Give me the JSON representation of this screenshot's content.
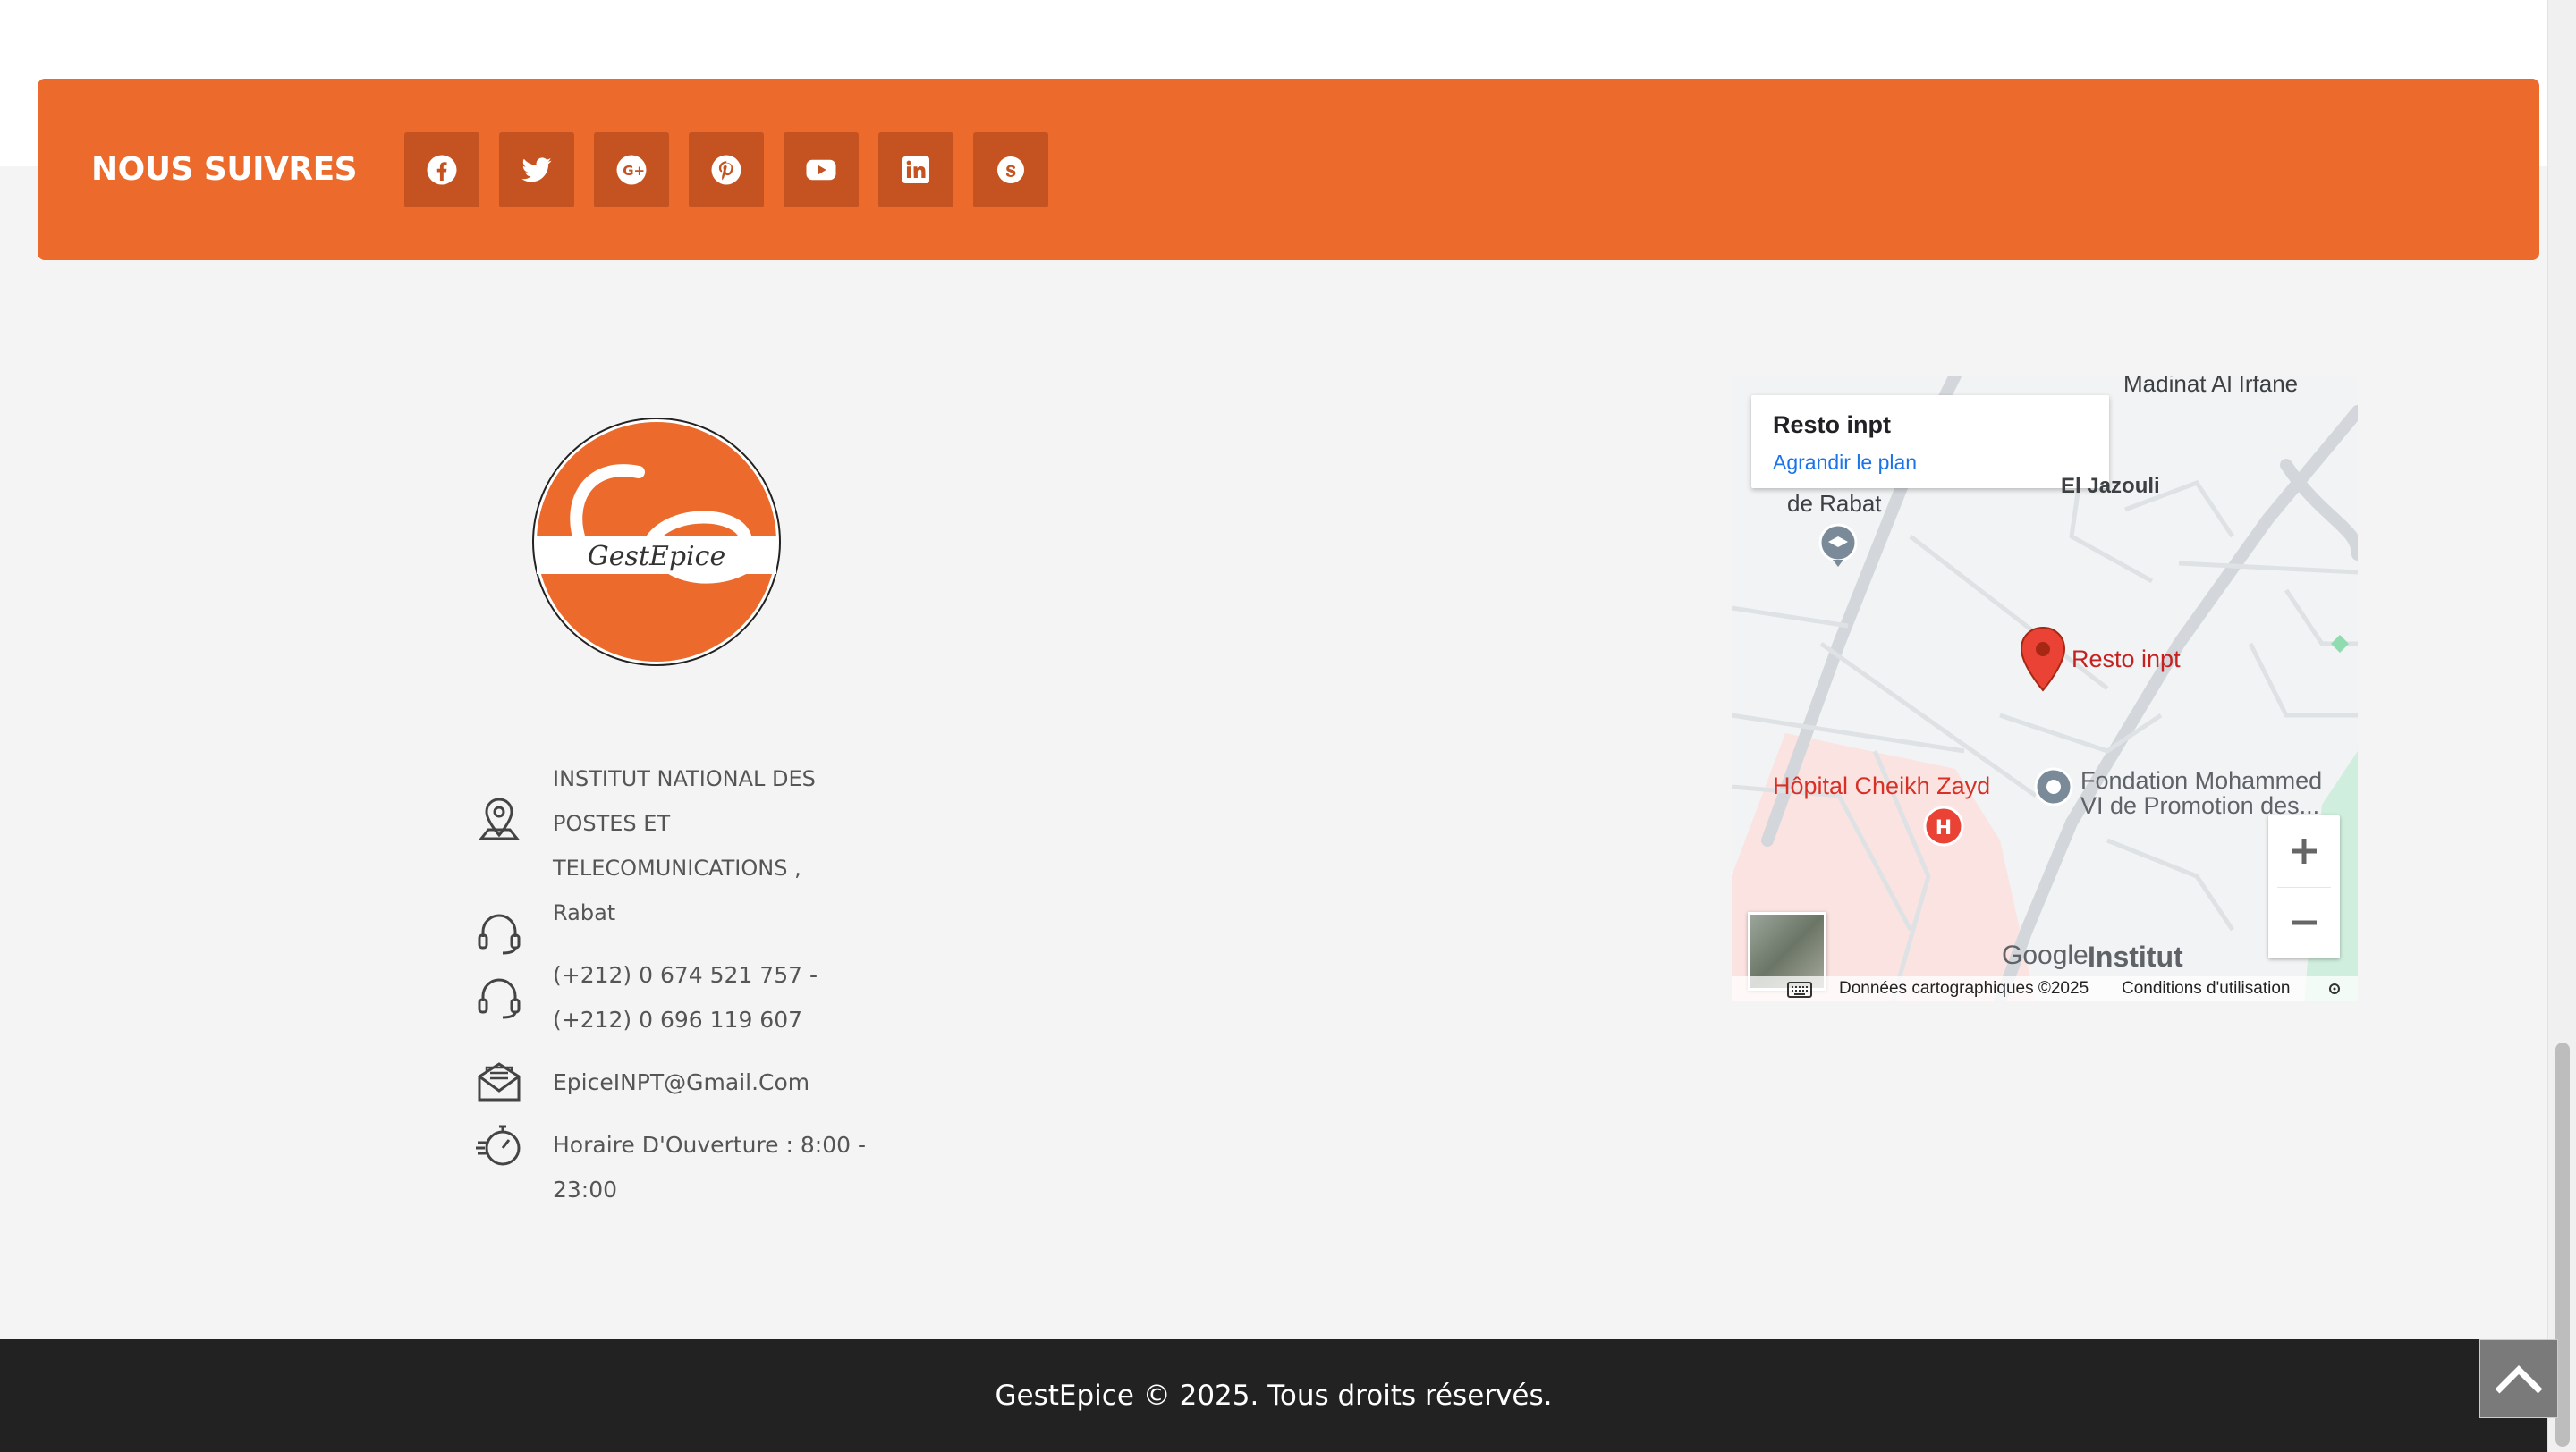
{
  "follow": {
    "title": "NOUS SUIVRES",
    "socials": [
      {
        "icon": "facebook-icon"
      },
      {
        "icon": "twitter-icon"
      },
      {
        "icon": "google-plus-icon"
      },
      {
        "icon": "pinterest-icon"
      },
      {
        "icon": "youtube-icon"
      },
      {
        "icon": "linkedin-icon"
      },
      {
        "icon": "skype-icon"
      }
    ]
  },
  "logo": {
    "text": "GestEpice",
    "color": "#eb6a2c"
  },
  "contact": {
    "address": [
      "INSTITUT NATIONAL DES",
      "POSTES ET",
      "TELECOMUNICATIONS ,",
      "Rabat"
    ],
    "phones": [
      "(+212) 0 674 521 757 -",
      "(+212) 0 696 119 607"
    ],
    "email": "EpiceINPT@Gmail.Com",
    "hours": [
      "Horaire D'Ouverture : 8:00 -",
      "23:00"
    ]
  },
  "map": {
    "card_title": "Resto inpt",
    "card_link": "Agrandir le plan",
    "marker_label": "Resto inpt",
    "labels": {
      "irfane": "Madinat Al Irfane",
      "jazouli": "El Jazouli",
      "rabat": "de Rabat",
      "hopital": "Hôpital Cheikh Zayd",
      "fondation1": "Fondation Mohammed",
      "fondation2": "VI de Promotion des...",
      "institut": "Institut",
      "google": "Google"
    },
    "footer_data": "Données cartographiques ©2025",
    "footer_terms": "Conditions d'utilisation"
  },
  "footer": {
    "copyright": "GestEpice © 2025. Tous droits réservés."
  },
  "colors": {
    "accent": "#eb6a2c",
    "social_bg": "#c45321",
    "footer_bg": "#222222"
  }
}
